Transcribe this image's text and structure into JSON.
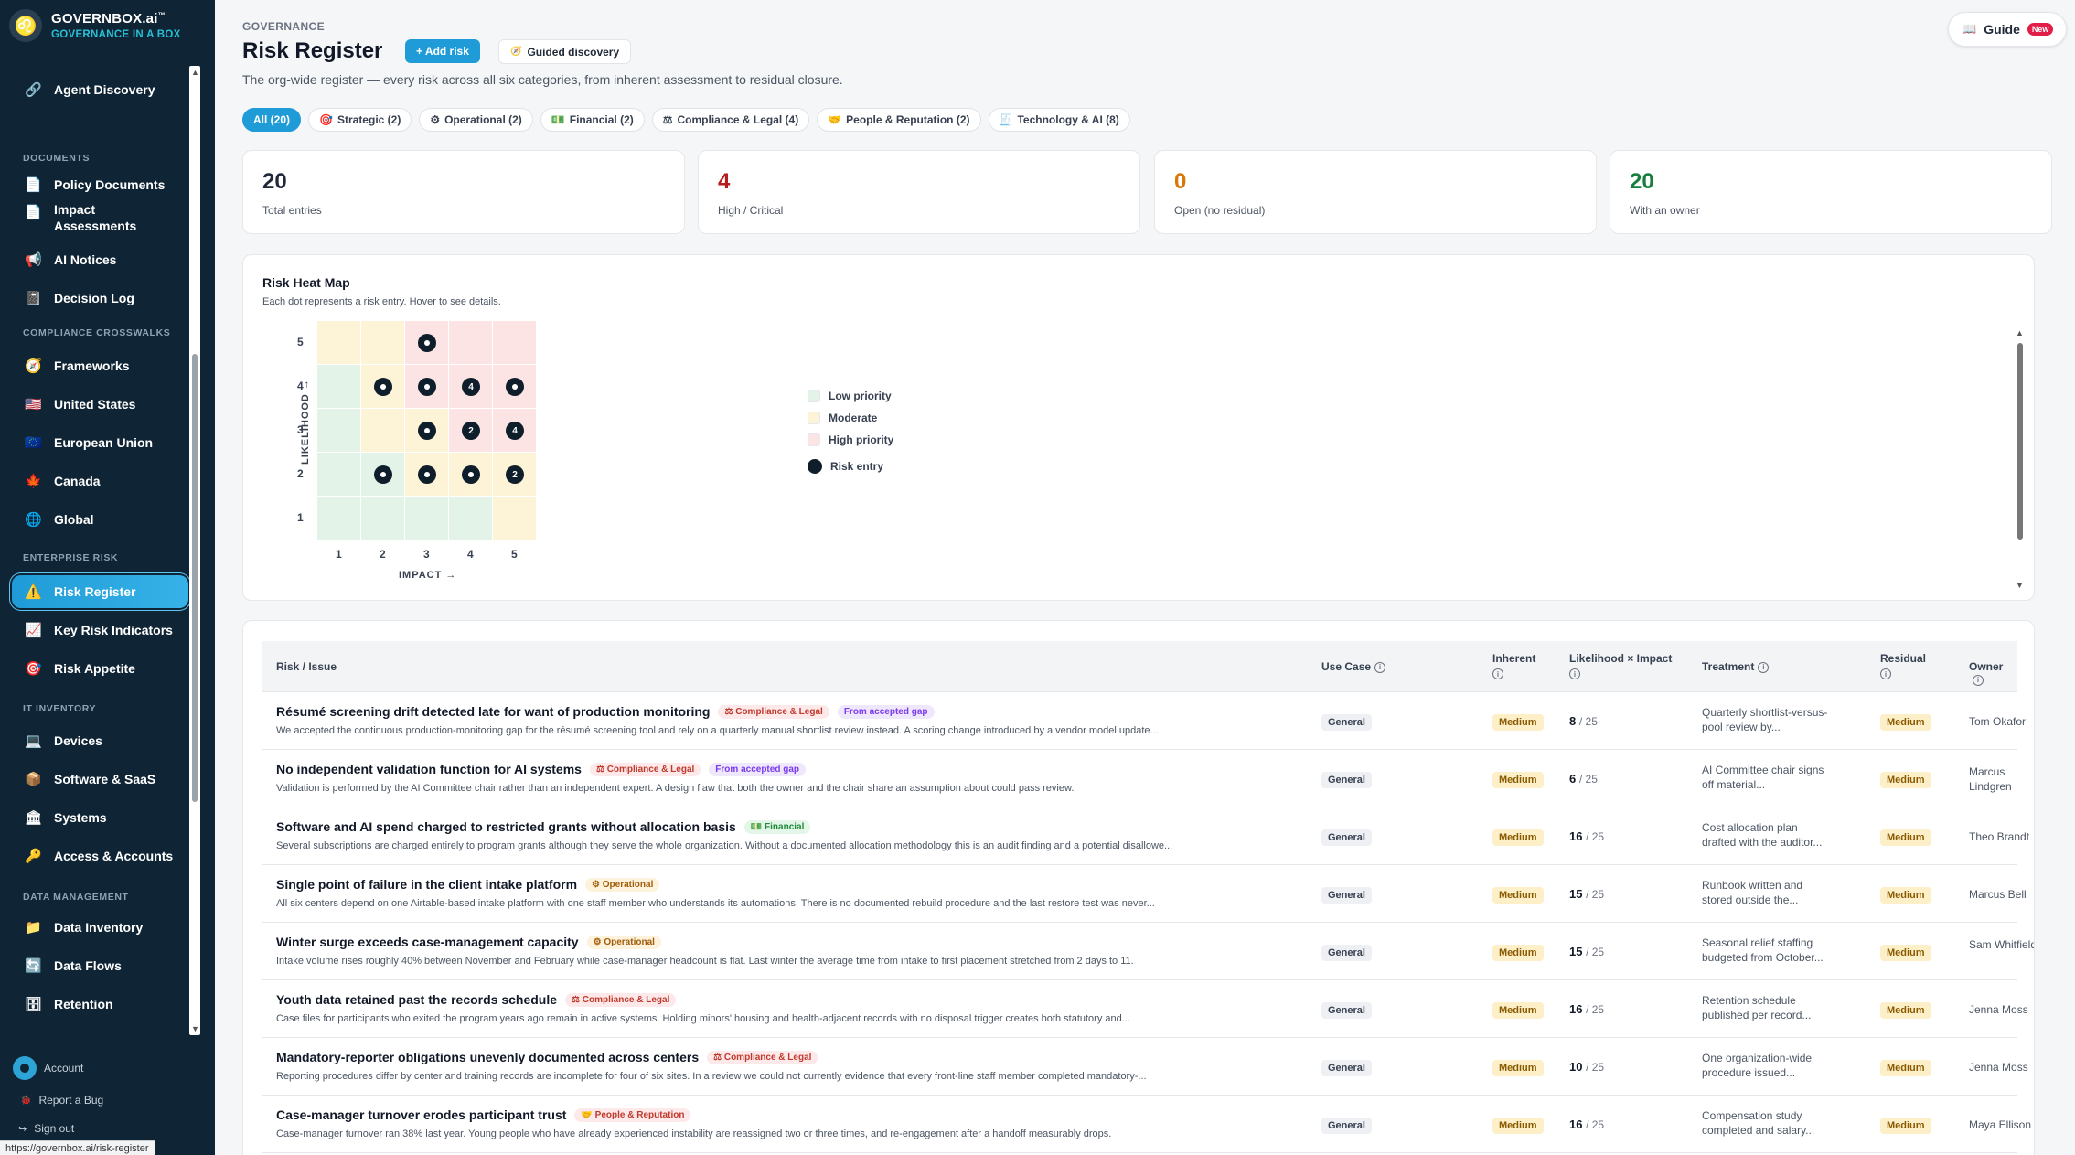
{
  "brand": {
    "name": "GOVERNBOX.ai",
    "tm": "™",
    "tagline": "GOVERNANCE IN A BOX"
  },
  "sidebar": {
    "agent_discovery": "Agent Discovery",
    "sections": {
      "documents": "DOCUMENTS",
      "crosswalks": "COMPLIANCE CROSSWALKS",
      "enterprise_risk": "ENTERPRISE RISK",
      "it_inventory": "IT INVENTORY",
      "data_management": "DATA MANAGEMENT"
    },
    "items": {
      "policy_documents": "Policy Documents",
      "impact_assessments": "Impact Assessments",
      "ai_notices": "AI Notices",
      "decision_log": "Decision Log",
      "frameworks": "Frameworks",
      "united_states": "United States",
      "european_union": "European Union",
      "canada": "Canada",
      "global": "Global",
      "risk_register": "Risk Register",
      "key_risk_indicators": "Key Risk Indicators",
      "risk_appetite": "Risk Appetite",
      "devices": "Devices",
      "software_saas": "Software & SaaS",
      "systems": "Systems",
      "access_accounts": "Access & Accounts",
      "data_inventory": "Data Inventory",
      "data_flows": "Data Flows",
      "retention": "Retention"
    },
    "footer": {
      "account": "Account",
      "report_bug": "Report a Bug",
      "sign_out": "Sign out"
    }
  },
  "status_url": "https://governbox.ai/risk-register",
  "header": {
    "crumb": "GOVERNANCE",
    "title": "Risk Register",
    "add_risk": "+ Add risk",
    "guided": "Guided discovery",
    "subtitle": "The org-wide register — every risk across all six categories, from inherent assessment to residual closure.",
    "guide": "Guide",
    "guide_badge": "New"
  },
  "filters": [
    {
      "label": "All (20)",
      "icon": ""
    },
    {
      "label": "Strategic (2)",
      "icon": "🎯"
    },
    {
      "label": "Operational (2)",
      "icon": "⚙"
    },
    {
      "label": "Financial (2)",
      "icon": "💵"
    },
    {
      "label": "Compliance & Legal (4)",
      "icon": "⚖"
    },
    {
      "label": "People & Reputation (2)",
      "icon": "🤝"
    },
    {
      "label": "Technology & AI (8)",
      "icon": "🧾"
    }
  ],
  "stats": [
    {
      "value": "20",
      "label": "Total entries",
      "color": "#111827"
    },
    {
      "value": "4",
      "label": "High / Critical",
      "color": "#b91c1c"
    },
    {
      "value": "0",
      "label": "Open (no residual)",
      "color": "#d97706"
    },
    {
      "value": "20",
      "label": "With an owner",
      "color": "#15803d"
    }
  ],
  "heatmap": {
    "title": "Risk Heat Map",
    "subtitle": "Each dot represents a risk entry. Hover to see details.",
    "y_label": "LIKELIHOOD →",
    "x_label": "IMPACT →",
    "x_ticks": [
      "1",
      "2",
      "3",
      "4",
      "5"
    ],
    "y_ticks": [
      "5",
      "4",
      "3",
      "2",
      "1"
    ],
    "colors": {
      "low": "#e3f3e8",
      "moderate": "#fdf3d7",
      "high": "#fde4e4"
    },
    "dots": [
      {
        "likelihood": 5,
        "impact": 3,
        "count": ""
      },
      {
        "likelihood": 4,
        "impact": 2,
        "count": ""
      },
      {
        "likelihood": 4,
        "impact": 3,
        "count": ""
      },
      {
        "likelihood": 4,
        "impact": 4,
        "count": "4"
      },
      {
        "likelihood": 4,
        "impact": 5,
        "count": ""
      },
      {
        "likelihood": 3,
        "impact": 3,
        "count": ""
      },
      {
        "likelihood": 3,
        "impact": 4,
        "count": "2"
      },
      {
        "likelihood": 3,
        "impact": 5,
        "count": "4"
      },
      {
        "likelihood": 2,
        "impact": 2,
        "count": ""
      },
      {
        "likelihood": 2,
        "impact": 3,
        "count": ""
      },
      {
        "likelihood": 2,
        "impact": 4,
        "count": ""
      },
      {
        "likelihood": 2,
        "impact": 5,
        "count": "2"
      }
    ],
    "legend": {
      "low": "Low priority",
      "moderate": "Moderate",
      "high": "High priority",
      "entry": "Risk entry"
    }
  },
  "table": {
    "headers": {
      "risk": "Risk / Issue",
      "use_case": "Use Case",
      "inherent": "Inherent",
      "lxi": "Likelihood × Impact",
      "treatment": "Treatment",
      "residual": "Residual",
      "owner": "Owner"
    },
    "rows": [
      {
        "title": "Résumé screening drift detected late for want of production monitoring",
        "tags": [
          [
            "⚖ Compliance & Legal",
            "comp"
          ],
          [
            "From accepted gap",
            "gap"
          ]
        ],
        "desc": "We accepted the continuous production-monitoring gap for the résumé screening tool and rely on a quarterly manual shortlist review instead. A scoring change introduced by a vendor model update...",
        "use_case": "General",
        "inherent": "Medium",
        "score": "8",
        "of": "/ 25",
        "treatment": "Quarterly shortlist-versus-pool review by...",
        "residual": "Medium",
        "owner": "Tom Okafor"
      },
      {
        "title": "No independent validation function for AI systems",
        "tags": [
          [
            "⚖ Compliance & Legal",
            "comp"
          ],
          [
            "From accepted gap",
            "gap"
          ]
        ],
        "desc": "Validation is performed by the AI Committee chair rather than an independent expert. A design flaw that both the owner and the chair share an assumption about could pass review.",
        "use_case": "General",
        "inherent": "Medium",
        "score": "6",
        "of": "/ 25",
        "treatment": "AI Committee chair signs off material...",
        "residual": "Medium",
        "owner": "Marcus Lindgren"
      },
      {
        "title": "Software and AI spend charged to restricted grants without allocation basis",
        "tags": [
          [
            "💵 Financial",
            "fin"
          ]
        ],
        "desc": "Several subscriptions are charged entirely to program grants although they serve the whole organization. Without a documented allocation methodology this is an audit finding and a potential disallowe...",
        "use_case": "General",
        "inherent": "Medium",
        "score": "16",
        "of": "/ 25",
        "treatment": "Cost allocation plan drafted with the auditor...",
        "residual": "Medium",
        "owner": "Theo Brandt"
      },
      {
        "title": "Single point of failure in the client intake platform",
        "tags": [
          [
            "⚙ Operational",
            "ops"
          ]
        ],
        "desc": "All six centers depend on one Airtable-based intake platform with one staff member who understands its automations. There is no documented rebuild procedure and the last restore test was never...",
        "use_case": "General",
        "inherent": "Medium",
        "score": "15",
        "of": "/ 25",
        "treatment": "Runbook written and stored outside the...",
        "residual": "Medium",
        "owner": "Marcus Bell"
      },
      {
        "title": "Winter surge exceeds case-management capacity",
        "tags": [
          [
            "⚙ Operational",
            "ops"
          ]
        ],
        "desc": "Intake volume rises roughly 40% between November and February while case-manager headcount is flat. Last winter the average time from intake to first placement stretched from 2 days to 11.",
        "use_case": "General",
        "inherent": "Medium",
        "score": "15",
        "of": "/ 25",
        "treatment": "Seasonal relief staffing budgeted from October...",
        "residual": "Medium",
        "owner": "Sam Whitfield"
      },
      {
        "title": "Youth data retained past the records schedule",
        "tags": [
          [
            "⚖ Compliance & Legal",
            "comp"
          ]
        ],
        "desc": "Case files for participants who exited the program years ago remain in active systems. Holding minors' housing and health-adjacent records with no disposal trigger creates both statutory and...",
        "use_case": "General",
        "inherent": "Medium",
        "score": "16",
        "of": "/ 25",
        "treatment": "Retention schedule published per record...",
        "residual": "Medium",
        "owner": "Jenna Moss"
      },
      {
        "title": "Mandatory-reporter obligations unevenly documented across centers",
        "tags": [
          [
            "⚖ Compliance & Legal",
            "comp"
          ]
        ],
        "desc": "Reporting procedures differ by center and training records are incomplete for four of six sites. In a review we could not currently evidence that every front-line staff member completed mandatory-...",
        "use_case": "General",
        "inherent": "Medium",
        "score": "10",
        "of": "/ 25",
        "treatment": "One organization-wide procedure issued...",
        "residual": "Medium",
        "owner": "Jenna Moss"
      },
      {
        "title": "Case-manager turnover erodes participant trust",
        "tags": [
          [
            "🤝 People & Reputation",
            "ppl"
          ]
        ],
        "desc": "Case-manager turnover ran 38% last year. Young people who have already experienced instability are reassigned two or three times, and re-engagement after a handoff measurably drops.",
        "use_case": "General",
        "inherent": "Medium",
        "score": "16",
        "of": "/ 25",
        "treatment": "Compensation study completed and salary...",
        "residual": "Medium",
        "owner": "Maya Ellison"
      }
    ]
  }
}
